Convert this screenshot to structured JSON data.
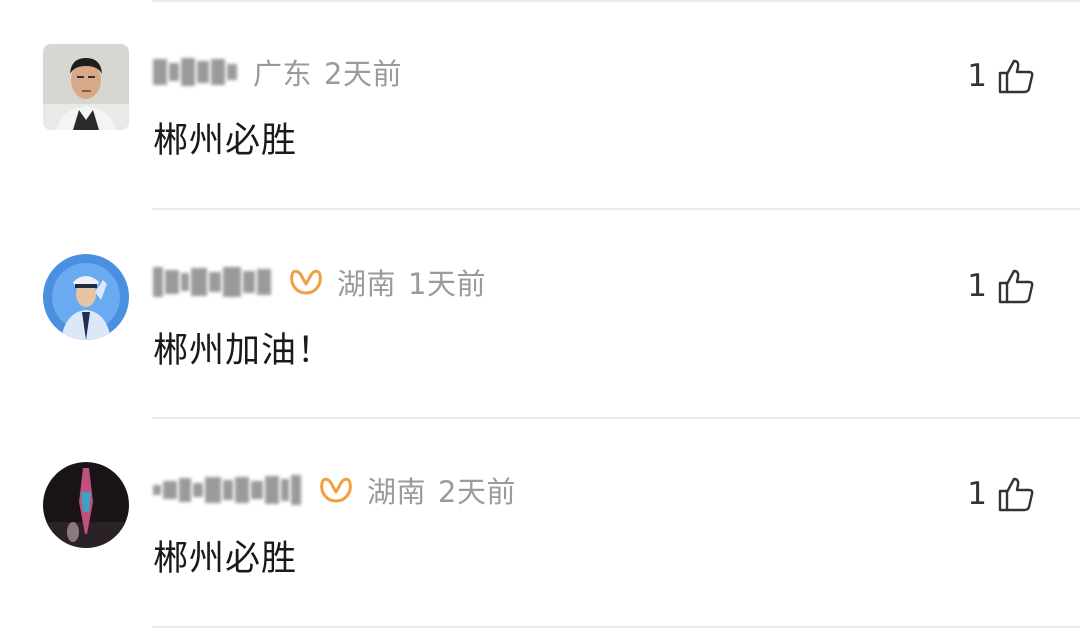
{
  "comments": [
    {
      "location": "广东",
      "time": "2天前",
      "text": "郴州必胜",
      "likes": "1",
      "vip": false,
      "avatar_icon": "person-photo-avatar"
    },
    {
      "location": "湖南",
      "time": "1天前",
      "text": "郴州加油！",
      "likes": "1",
      "vip": true,
      "avatar_icon": "police-salute-avatar"
    },
    {
      "location": "湖南",
      "time": "2天前",
      "text": "郴州必胜",
      "likes": "1",
      "vip": true,
      "avatar_icon": "tower-night-avatar"
    }
  ],
  "colors": {
    "meta_gray": "#9b9b9b",
    "vip_gold": "#f0a040",
    "text_dark": "#1a1a1a",
    "divider": "#ebebeb"
  },
  "icons": {
    "like": "thumbs-up-icon",
    "vip": "vip-badge-icon"
  }
}
